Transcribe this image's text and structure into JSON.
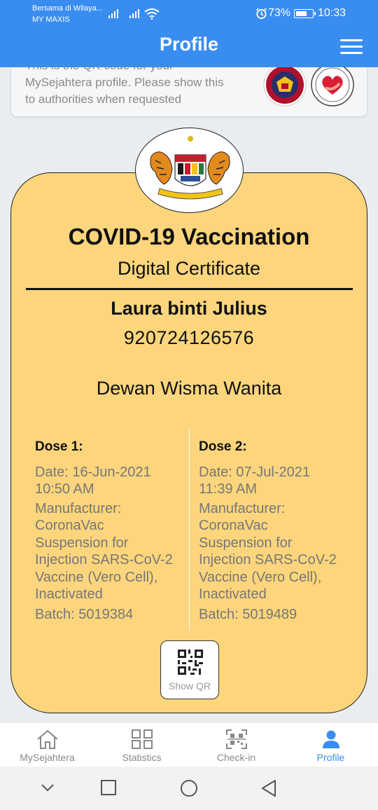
{
  "status_bar": {
    "carrier_line1": "Bersama di Wilaya...",
    "carrier_line2": "MY MAXIS",
    "battery_text": "73%",
    "battery_level": 0.73,
    "time": "10:33"
  },
  "header": {
    "title": "Profile"
  },
  "info_card": {
    "text": "This is the QR code for your MySejahtera profile. Please show this to authorities when requested"
  },
  "certificate": {
    "title": "COVID-19 Vaccination",
    "subtitle": "Digital Certificate",
    "name": "Laura binti Julius",
    "id_number": "920724126576",
    "location": "Dewan Wisma Wanita",
    "doses": [
      {
        "title": "Dose 1:",
        "date_line1": "Date: 16-Jun-2021",
        "date_line2": "10:50 AM",
        "manufacturer_label": "Manufacturer:",
        "manufacturer_lines": [
          "CoronaVac",
          "Suspension for",
          "Injection SARS-CoV-2",
          "Vaccine (Vero Cell),",
          "Inactivated"
        ],
        "batch": "Batch: 5019384"
      },
      {
        "title": "Dose 2:",
        "date_line1": "Date: 07-Jul-2021",
        "date_line2": "11:39 AM",
        "manufacturer_label": "Manufacturer:",
        "manufacturer_lines": [
          "CoronaVac",
          "Suspension for",
          "Injection SARS-CoV-2",
          "Vaccine (Vero Cell),",
          "Inactivated"
        ],
        "batch": "Batch: 5019489"
      }
    ],
    "show_qr_label": "Show QR"
  },
  "bottom_nav": {
    "items": [
      {
        "label": "MySejahtera",
        "icon": "home-icon"
      },
      {
        "label": "Statistics",
        "icon": "grid-icon"
      },
      {
        "label": "Check-in",
        "icon": "qr-scan-icon"
      },
      {
        "label": "Profile",
        "icon": "person-icon",
        "active": true
      }
    ]
  },
  "colors": {
    "primary": "#3a8df0",
    "certificate_bg": "#fcd57c",
    "background": "#e9edf0"
  }
}
